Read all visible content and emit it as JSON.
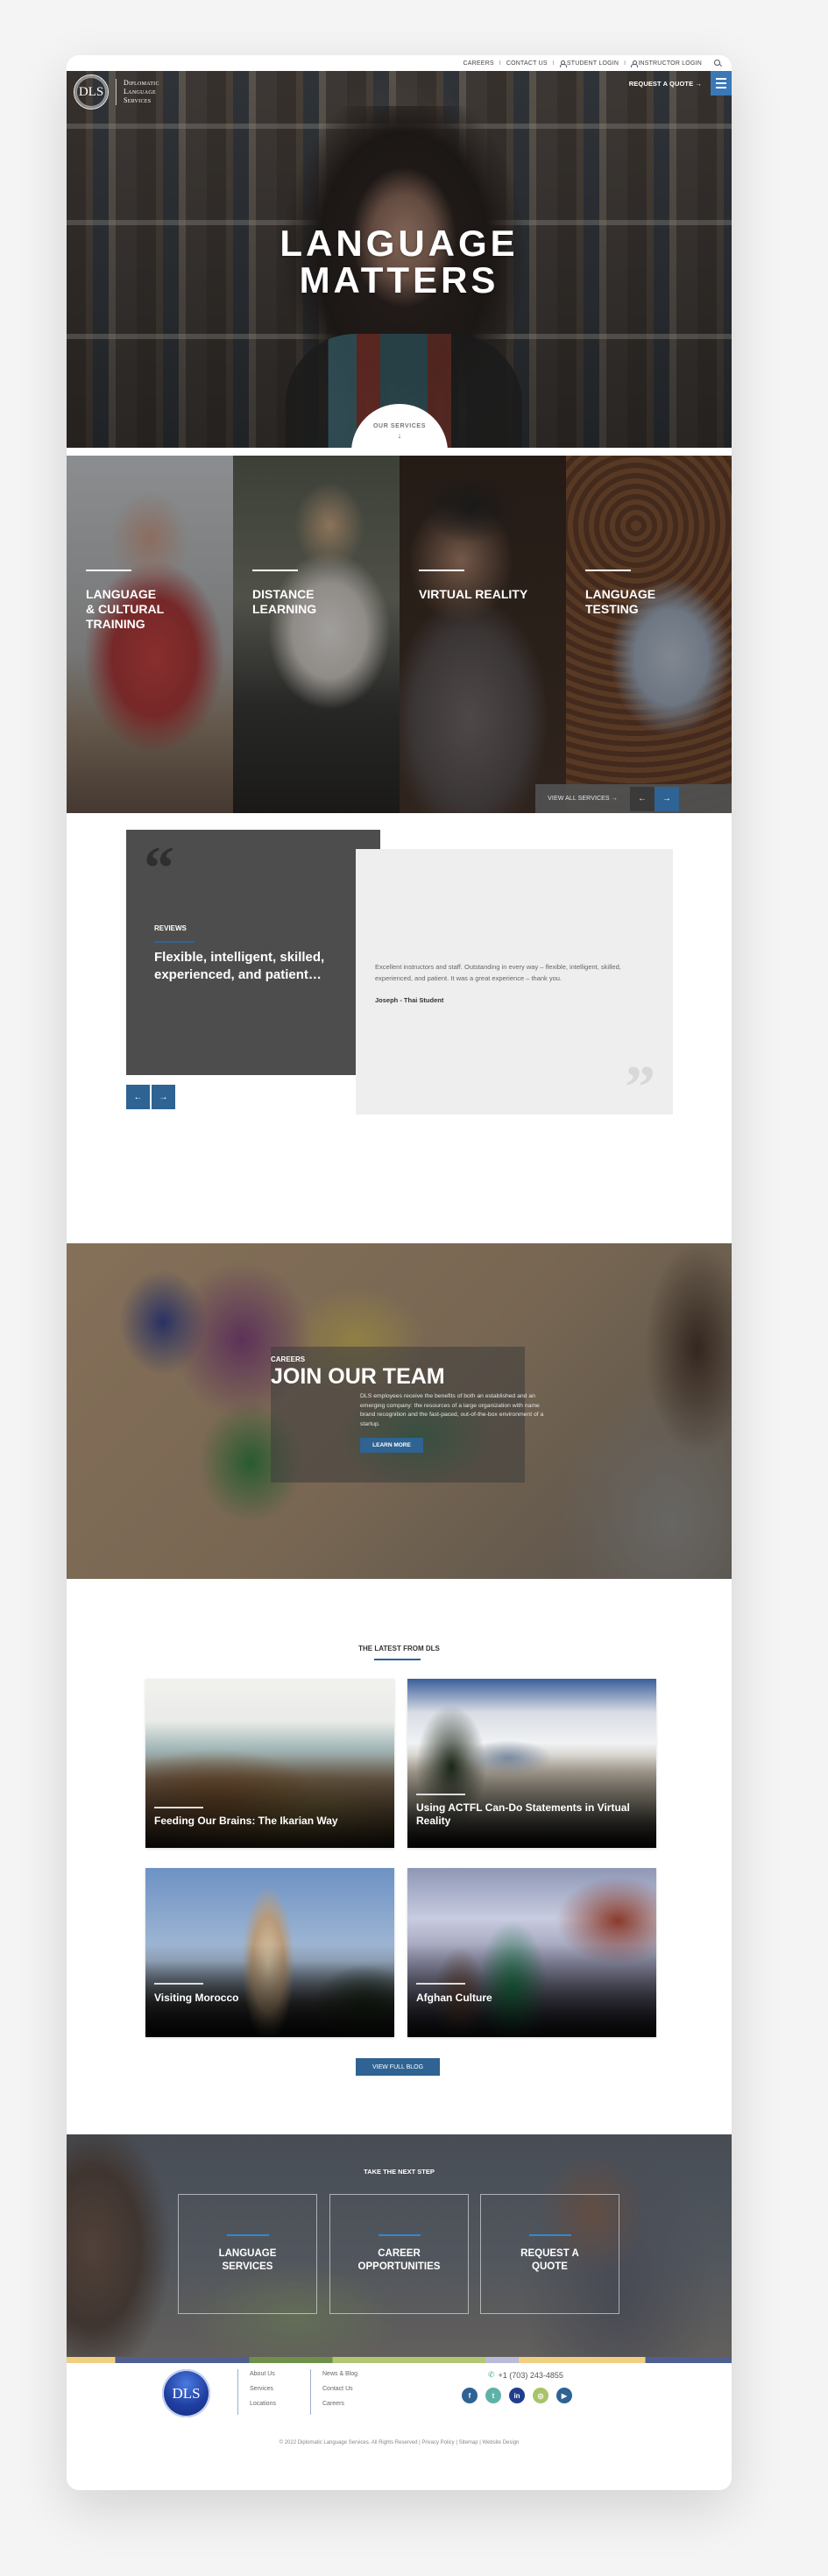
{
  "utility_nav": {
    "careers": "CAREERS",
    "contact": "CONTACT US",
    "student_login": "STUDENT LOGIN",
    "instructor_login": "INSTRUCTOR LOGIN",
    "separator": "I"
  },
  "brand": {
    "logo_initials": "DLS",
    "name_line1": "Diplomatic",
    "name_line2": "Language",
    "name_line3": "Services"
  },
  "header": {
    "request_quote": "REQUEST A QUOTE →"
  },
  "hero": {
    "title_line1": "LANGUAGE",
    "title_line2": "MATTERS",
    "services_tab_label": "OUR SERVICES",
    "services_tab_arrow": "↓"
  },
  "services": {
    "items": [
      {
        "title_line1": "Language",
        "title_line2": "& Cultural",
        "title_line3": "Training"
      },
      {
        "title_line1": "Distance",
        "title_line2": "Learning"
      },
      {
        "title_line1": "Virtual Reality"
      },
      {
        "title_line1": "Language",
        "title_line2": "Testing"
      }
    ],
    "view_all": "VIEW ALL SERVICES →",
    "prev": "←",
    "next": "→"
  },
  "reviews": {
    "quote_open": "“",
    "quote_close": "”",
    "kicker": "REVIEWS",
    "headline": "Flexible, intelligent, skilled, experienced, and patient…",
    "text": "Excellent instructors and staff. Outstanding in every way – flexible, intelligent, skilled, experienced, and patient. It was a great experience – thank you.",
    "author": "Joseph - Thai Student",
    "prev": "←",
    "next": "→"
  },
  "careers": {
    "kicker": "CAREERS",
    "title": "JOIN OUR TEAM",
    "description": "DLS employees receive the benefits of both an established and an emerging company: the resources of a large organization with name brand recognition and the fast-paced, out-of-the-box environment of a startup.",
    "button": "LEARN MORE"
  },
  "blog": {
    "heading": "THE LATEST FROM DLS",
    "posts": [
      {
        "title": "Feeding Our Brains: The Ikarian Way"
      },
      {
        "title": "Using ACTFL Can-Do Statements in Virtual Reality"
      },
      {
        "title": "Visiting Morocco"
      },
      {
        "title": "Afghan Culture"
      }
    ],
    "button": "VIEW FULL BLOG"
  },
  "cta": {
    "heading": "TAKE THE NEXT STEP",
    "boxes": [
      {
        "line1": "Language",
        "line2": "Services"
      },
      {
        "line1": "Career",
        "line2": "Opportunities"
      },
      {
        "line1": "Request A",
        "line2": "Quote"
      }
    ]
  },
  "footer": {
    "logo_initials": "DLS",
    "col1": [
      "About Us",
      "Services",
      "Locations"
    ],
    "col2": [
      "News & Blog",
      "Contact Us",
      "Careers"
    ],
    "phone": "+1 (703) 243-4855",
    "socials": [
      {
        "name": "facebook",
        "glyph": "f",
        "color": "#2e6393"
      },
      {
        "name": "twitter",
        "glyph": "t",
        "color": "#5fb3a6"
      },
      {
        "name": "linkedin",
        "glyph": "in",
        "color": "#1f3e8c"
      },
      {
        "name": "instagram",
        "glyph": "◎",
        "color": "#a8c36a"
      },
      {
        "name": "youtube",
        "glyph": "▶",
        "color": "#2e6393"
      }
    ],
    "copyright": "© 2022 Diplomatic Language Services. All Rights Reserved | Privacy Policy | Sitemap | Website Design"
  },
  "colors": {
    "brand_blue": "#2e6393",
    "menu_blue": "#3a78b8",
    "dark_panel": "#4d4d4d",
    "light_panel": "#eeeeee"
  }
}
